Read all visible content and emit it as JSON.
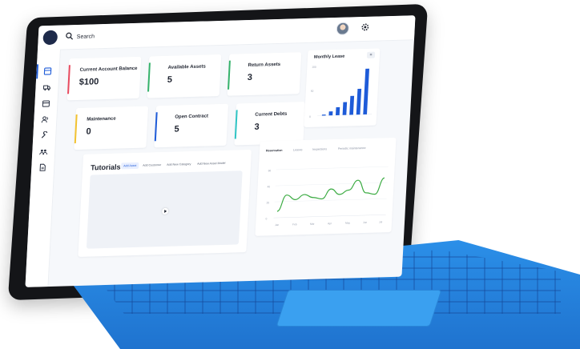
{
  "search": {
    "placeholder": "Search"
  },
  "cards": [
    {
      "label": "Current Account Balance",
      "value": "$100",
      "color": "#e84a5f"
    },
    {
      "label": "Available Assets",
      "value": "5",
      "color": "#35b26b"
    },
    {
      "label": "Return Assets",
      "value": "3",
      "color": "#35b26b"
    },
    {
      "label": "Maintenance",
      "value": "0",
      "color": "#f2c230"
    },
    {
      "label": "Open Contract",
      "value": "5",
      "color": "#1e5bd8"
    },
    {
      "label": "Current Debts",
      "value": "3",
      "color": "#2ec4c4"
    }
  ],
  "monthly_lease": {
    "title": "Monthly Lease",
    "menu_icon": "menu-icon",
    "ticks": [
      "100",
      "50",
      "0"
    ]
  },
  "tutorials": {
    "title": "Tutorials",
    "tabs": [
      "Add Asset",
      "Add Customer",
      "Add New Category",
      "Add New Asset Model"
    ],
    "play_icon": "play-icon"
  },
  "revenue": {
    "tabs": [
      "Reservation",
      "Leases",
      "Inspections",
      "Periodic maintenance"
    ],
    "y_ticks": [
      "60",
      "40",
      "20",
      "0"
    ],
    "x_ticks": [
      "Jan",
      "Feb",
      "Mar",
      "Apr",
      "May",
      "Jun",
      "Jul"
    ]
  },
  "chart_data": [
    {
      "type": "bar",
      "title": "Monthly Lease",
      "categories": [
        "1",
        "2",
        "3",
        "4",
        "5",
        "6",
        "7"
      ],
      "values": [
        2,
        8,
        16,
        26,
        38,
        52,
        92
      ],
      "ylim": [
        0,
        100
      ],
      "color": "#1e5bd8"
    },
    {
      "type": "line",
      "x": [
        "Jan",
        "",
        "Feb",
        "",
        "Mar",
        "",
        "Apr",
        "",
        "May",
        "",
        "Jun",
        "",
        "Jul"
      ],
      "values": [
        8,
        28,
        22,
        28,
        24,
        22,
        34,
        27,
        32,
        44,
        28,
        26,
        46
      ],
      "ylim": [
        0,
        60
      ],
      "color": "#3bab42"
    }
  ],
  "icons": {
    "sidebar": [
      "dashboard-icon",
      "truck-icon",
      "calendar-icon",
      "users-icon",
      "wrench-icon",
      "group-icon",
      "document-icon"
    ],
    "top": [
      "search-icon",
      "avatar",
      "gear-icon"
    ]
  }
}
